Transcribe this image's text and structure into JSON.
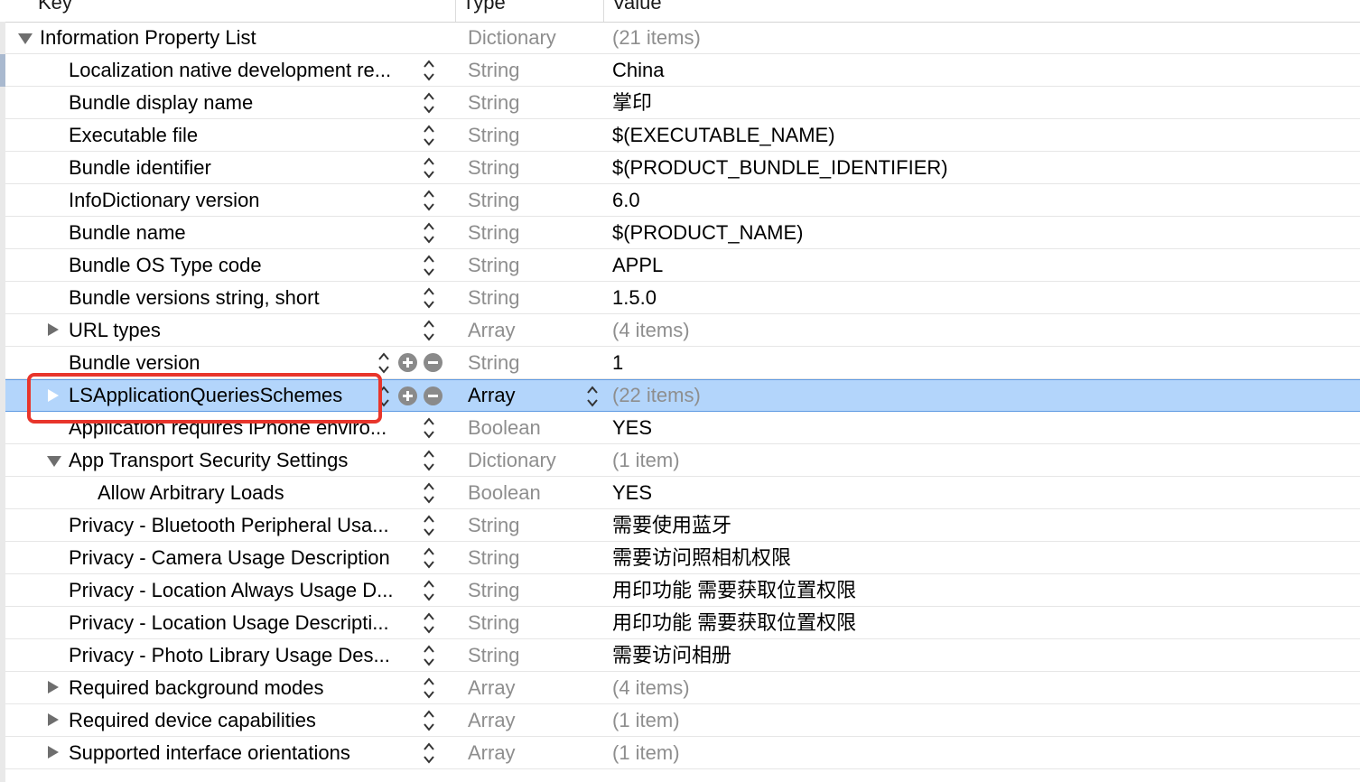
{
  "header": {
    "key": "Key",
    "type": "Type",
    "value": "Value"
  },
  "rows": [
    {
      "key": "Information Property List",
      "type": "Dictionary",
      "value": "(21 items)",
      "muted": true,
      "level": 0,
      "tri": "down",
      "stepper": false
    },
    {
      "key": "Localization native development re...",
      "type": "String",
      "value": "China",
      "level": 1,
      "stepper": true
    },
    {
      "key": "Bundle display name",
      "type": "String",
      "value": "掌印",
      "level": 1,
      "stepper": true
    },
    {
      "key": "Executable file",
      "type": "String",
      "value": "$(EXECUTABLE_NAME)",
      "level": 1,
      "stepper": true
    },
    {
      "key": "Bundle identifier",
      "type": "String",
      "value": "$(PRODUCT_BUNDLE_IDENTIFIER)",
      "level": 1,
      "stepper": true
    },
    {
      "key": "InfoDictionary version",
      "type": "String",
      "value": "6.0",
      "level": 1,
      "stepper": true
    },
    {
      "key": "Bundle name",
      "type": "String",
      "value": "$(PRODUCT_NAME)",
      "level": 1,
      "stepper": true
    },
    {
      "key": "Bundle OS Type code",
      "type": "String",
      "value": "APPL",
      "level": 1,
      "stepper": true
    },
    {
      "key": "Bundle versions string, short",
      "type": "String",
      "value": "1.5.0",
      "level": 1,
      "stepper": true
    },
    {
      "key": "URL types",
      "type": "Array",
      "value": "(4 items)",
      "muted": true,
      "level": 1,
      "tri": "right",
      "stepper": true
    },
    {
      "key": "Bundle version",
      "type": "String",
      "value": "1",
      "level": 1,
      "stepper": true,
      "addremove": true
    },
    {
      "key": "LSApplicationQueriesSchemes",
      "type": "Array",
      "value": "(22 items)",
      "muted": true,
      "level": 1,
      "tri": "right",
      "stepper": true,
      "addremove": true,
      "selected": true
    },
    {
      "key": "Application requires iPhone enviro...",
      "type": "Boolean",
      "value": "YES",
      "level": 1,
      "stepper": true
    },
    {
      "key": "App Transport Security Settings",
      "type": "Dictionary",
      "value": "(1 item)",
      "muted": true,
      "level": 1,
      "tri": "down",
      "stepper": true
    },
    {
      "key": "Allow Arbitrary Loads",
      "type": "Boolean",
      "value": "YES",
      "level": 2,
      "stepper": true
    },
    {
      "key": "Privacy - Bluetooth Peripheral Usa...",
      "type": "String",
      "value": "需要使用蓝牙",
      "level": 1,
      "stepper": true
    },
    {
      "key": "Privacy - Camera Usage Description",
      "type": "String",
      "value": "需要访问照相机权限",
      "level": 1,
      "stepper": true
    },
    {
      "key": "Privacy - Location Always Usage D...",
      "type": "String",
      "value": "用印功能 需要获取位置权限",
      "level": 1,
      "stepper": true
    },
    {
      "key": "Privacy - Location Usage Descripti...",
      "type": "String",
      "value": "用印功能 需要获取位置权限",
      "level": 1,
      "stepper": true
    },
    {
      "key": "Privacy - Photo Library Usage Des...",
      "type": "String",
      "value": "需要访问相册",
      "level": 1,
      "stepper": true
    },
    {
      "key": "Required background modes",
      "type": "Array",
      "value": "(4 items)",
      "muted": true,
      "level": 1,
      "tri": "right",
      "stepper": true
    },
    {
      "key": "Required device capabilities",
      "type": "Array",
      "value": "(1 item)",
      "muted": true,
      "level": 1,
      "tri": "right",
      "stepper": true
    },
    {
      "key": "Supported interface orientations",
      "type": "Array",
      "value": "(1 item)",
      "muted": true,
      "level": 1,
      "tri": "right",
      "stepper": true
    }
  ],
  "colors": {
    "selection": "#b3d5fb",
    "highlight_box": "#e8352b",
    "muted_text": "#8e8e8e"
  }
}
